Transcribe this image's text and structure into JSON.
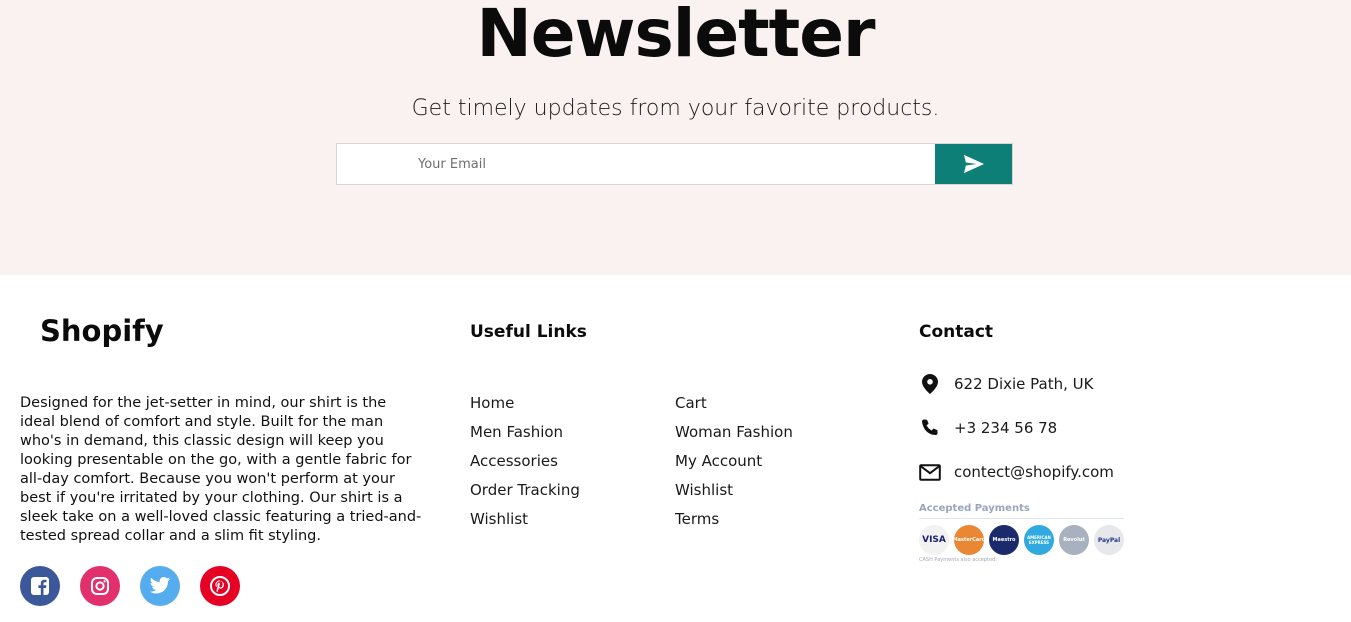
{
  "newsletter": {
    "title": "Newsletter",
    "subtitle": "Get timely updates from your favorite products.",
    "email_placeholder": "Your Email",
    "email_value": "",
    "send_icon": "send-icon",
    "band_color": "#f9f2f1",
    "button_color": "#0d7f77"
  },
  "footer": {
    "brand": "Shopify",
    "about": "Designed for the jet-setter in mind, our shirt is the ideal blend of comfort and style. Built for the man who's in demand, this classic design will keep you looking presentable on the go, with a gentle fabric for all-day comfort. Because you won't perform at your best if you're irritated by your clothing. Our shirt is a sleek take on a well-loved classic featuring a tried-and-tested spread collar and a slim fit styling.",
    "socials": [
      {
        "name": "facebook",
        "icon": "facebook-icon",
        "color": "#3b5998"
      },
      {
        "name": "instagram",
        "icon": "instagram-icon",
        "color": "#e1306c"
      },
      {
        "name": "twitter",
        "icon": "twitter-icon",
        "color": "#55acee"
      },
      {
        "name": "pinterest",
        "icon": "pinterest-icon",
        "color": "#e60023"
      }
    ],
    "useful_links": {
      "title": "Useful Links",
      "col1": [
        "Home",
        "Men Fashion",
        "Accessories",
        "Order Tracking",
        "Wishlist"
      ],
      "col2": [
        "Cart",
        "Woman Fashion",
        "My Account",
        "Wishlist",
        "Terms"
      ]
    },
    "contact": {
      "title": "Contact",
      "address": "622 Dixie Path, UK",
      "phone": "+3 234 56 78",
      "email": "contect@shopify.com"
    },
    "payments": {
      "title": "Accepted Payments",
      "methods": [
        "VISA",
        "MasterCard",
        "Maestro",
        "AMERICAN EXPRESS",
        "Revolut",
        "PayPal"
      ],
      "note": "CASH Payments also accepted."
    }
  }
}
